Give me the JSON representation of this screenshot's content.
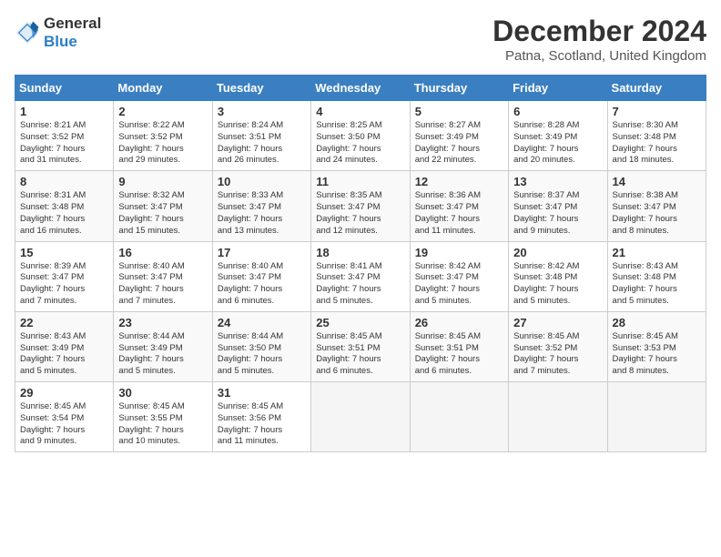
{
  "logo": {
    "general": "General",
    "blue": "Blue"
  },
  "title": "December 2024",
  "location": "Patna, Scotland, United Kingdom",
  "days_of_week": [
    "Sunday",
    "Monday",
    "Tuesday",
    "Wednesday",
    "Thursday",
    "Friday",
    "Saturday"
  ],
  "weeks": [
    [
      {
        "num": "1",
        "sunrise": "8:21 AM",
        "sunset": "3:52 PM",
        "daylight": "7 hours and 31 minutes."
      },
      {
        "num": "2",
        "sunrise": "8:22 AM",
        "sunset": "3:52 PM",
        "daylight": "7 hours and 29 minutes."
      },
      {
        "num": "3",
        "sunrise": "8:24 AM",
        "sunset": "3:51 PM",
        "daylight": "7 hours and 26 minutes."
      },
      {
        "num": "4",
        "sunrise": "8:25 AM",
        "sunset": "3:50 PM",
        "daylight": "7 hours and 24 minutes."
      },
      {
        "num": "5",
        "sunrise": "8:27 AM",
        "sunset": "3:49 PM",
        "daylight": "7 hours and 22 minutes."
      },
      {
        "num": "6",
        "sunrise": "8:28 AM",
        "sunset": "3:49 PM",
        "daylight": "7 hours and 20 minutes."
      },
      {
        "num": "7",
        "sunrise": "8:30 AM",
        "sunset": "3:48 PM",
        "daylight": "7 hours and 18 minutes."
      }
    ],
    [
      {
        "num": "8",
        "sunrise": "8:31 AM",
        "sunset": "3:48 PM",
        "daylight": "7 hours and 16 minutes."
      },
      {
        "num": "9",
        "sunrise": "8:32 AM",
        "sunset": "3:47 PM",
        "daylight": "7 hours and 15 minutes."
      },
      {
        "num": "10",
        "sunrise": "8:33 AM",
        "sunset": "3:47 PM",
        "daylight": "7 hours and 13 minutes."
      },
      {
        "num": "11",
        "sunrise": "8:35 AM",
        "sunset": "3:47 PM",
        "daylight": "7 hours and 12 minutes."
      },
      {
        "num": "12",
        "sunrise": "8:36 AM",
        "sunset": "3:47 PM",
        "daylight": "7 hours and 11 minutes."
      },
      {
        "num": "13",
        "sunrise": "8:37 AM",
        "sunset": "3:47 PM",
        "daylight": "7 hours and 9 minutes."
      },
      {
        "num": "14",
        "sunrise": "8:38 AM",
        "sunset": "3:47 PM",
        "daylight": "7 hours and 8 minutes."
      }
    ],
    [
      {
        "num": "15",
        "sunrise": "8:39 AM",
        "sunset": "3:47 PM",
        "daylight": "7 hours and 7 minutes."
      },
      {
        "num": "16",
        "sunrise": "8:40 AM",
        "sunset": "3:47 PM",
        "daylight": "7 hours and 7 minutes."
      },
      {
        "num": "17",
        "sunrise": "8:40 AM",
        "sunset": "3:47 PM",
        "daylight": "7 hours and 6 minutes."
      },
      {
        "num": "18",
        "sunrise": "8:41 AM",
        "sunset": "3:47 PM",
        "daylight": "7 hours and 5 minutes."
      },
      {
        "num": "19",
        "sunrise": "8:42 AM",
        "sunset": "3:47 PM",
        "daylight": "7 hours and 5 minutes."
      },
      {
        "num": "20",
        "sunrise": "8:42 AM",
        "sunset": "3:48 PM",
        "daylight": "7 hours and 5 minutes."
      },
      {
        "num": "21",
        "sunrise": "8:43 AM",
        "sunset": "3:48 PM",
        "daylight": "7 hours and 5 minutes."
      }
    ],
    [
      {
        "num": "22",
        "sunrise": "8:43 AM",
        "sunset": "3:49 PM",
        "daylight": "7 hours and 5 minutes."
      },
      {
        "num": "23",
        "sunrise": "8:44 AM",
        "sunset": "3:49 PM",
        "daylight": "7 hours and 5 minutes."
      },
      {
        "num": "24",
        "sunrise": "8:44 AM",
        "sunset": "3:50 PM",
        "daylight": "7 hours and 5 minutes."
      },
      {
        "num": "25",
        "sunrise": "8:45 AM",
        "sunset": "3:51 PM",
        "daylight": "7 hours and 6 minutes."
      },
      {
        "num": "26",
        "sunrise": "8:45 AM",
        "sunset": "3:51 PM",
        "daylight": "7 hours and 6 minutes."
      },
      {
        "num": "27",
        "sunrise": "8:45 AM",
        "sunset": "3:52 PM",
        "daylight": "7 hours and 7 minutes."
      },
      {
        "num": "28",
        "sunrise": "8:45 AM",
        "sunset": "3:53 PM",
        "daylight": "7 hours and 8 minutes."
      }
    ],
    [
      {
        "num": "29",
        "sunrise": "8:45 AM",
        "sunset": "3:54 PM",
        "daylight": "7 hours and 9 minutes."
      },
      {
        "num": "30",
        "sunrise": "8:45 AM",
        "sunset": "3:55 PM",
        "daylight": "7 hours and 10 minutes."
      },
      {
        "num": "31",
        "sunrise": "8:45 AM",
        "sunset": "3:56 PM",
        "daylight": "7 hours and 11 minutes."
      },
      null,
      null,
      null,
      null
    ]
  ],
  "labels": {
    "sunrise": "Sunrise:",
    "sunset": "Sunset:",
    "daylight": "Daylight:"
  }
}
